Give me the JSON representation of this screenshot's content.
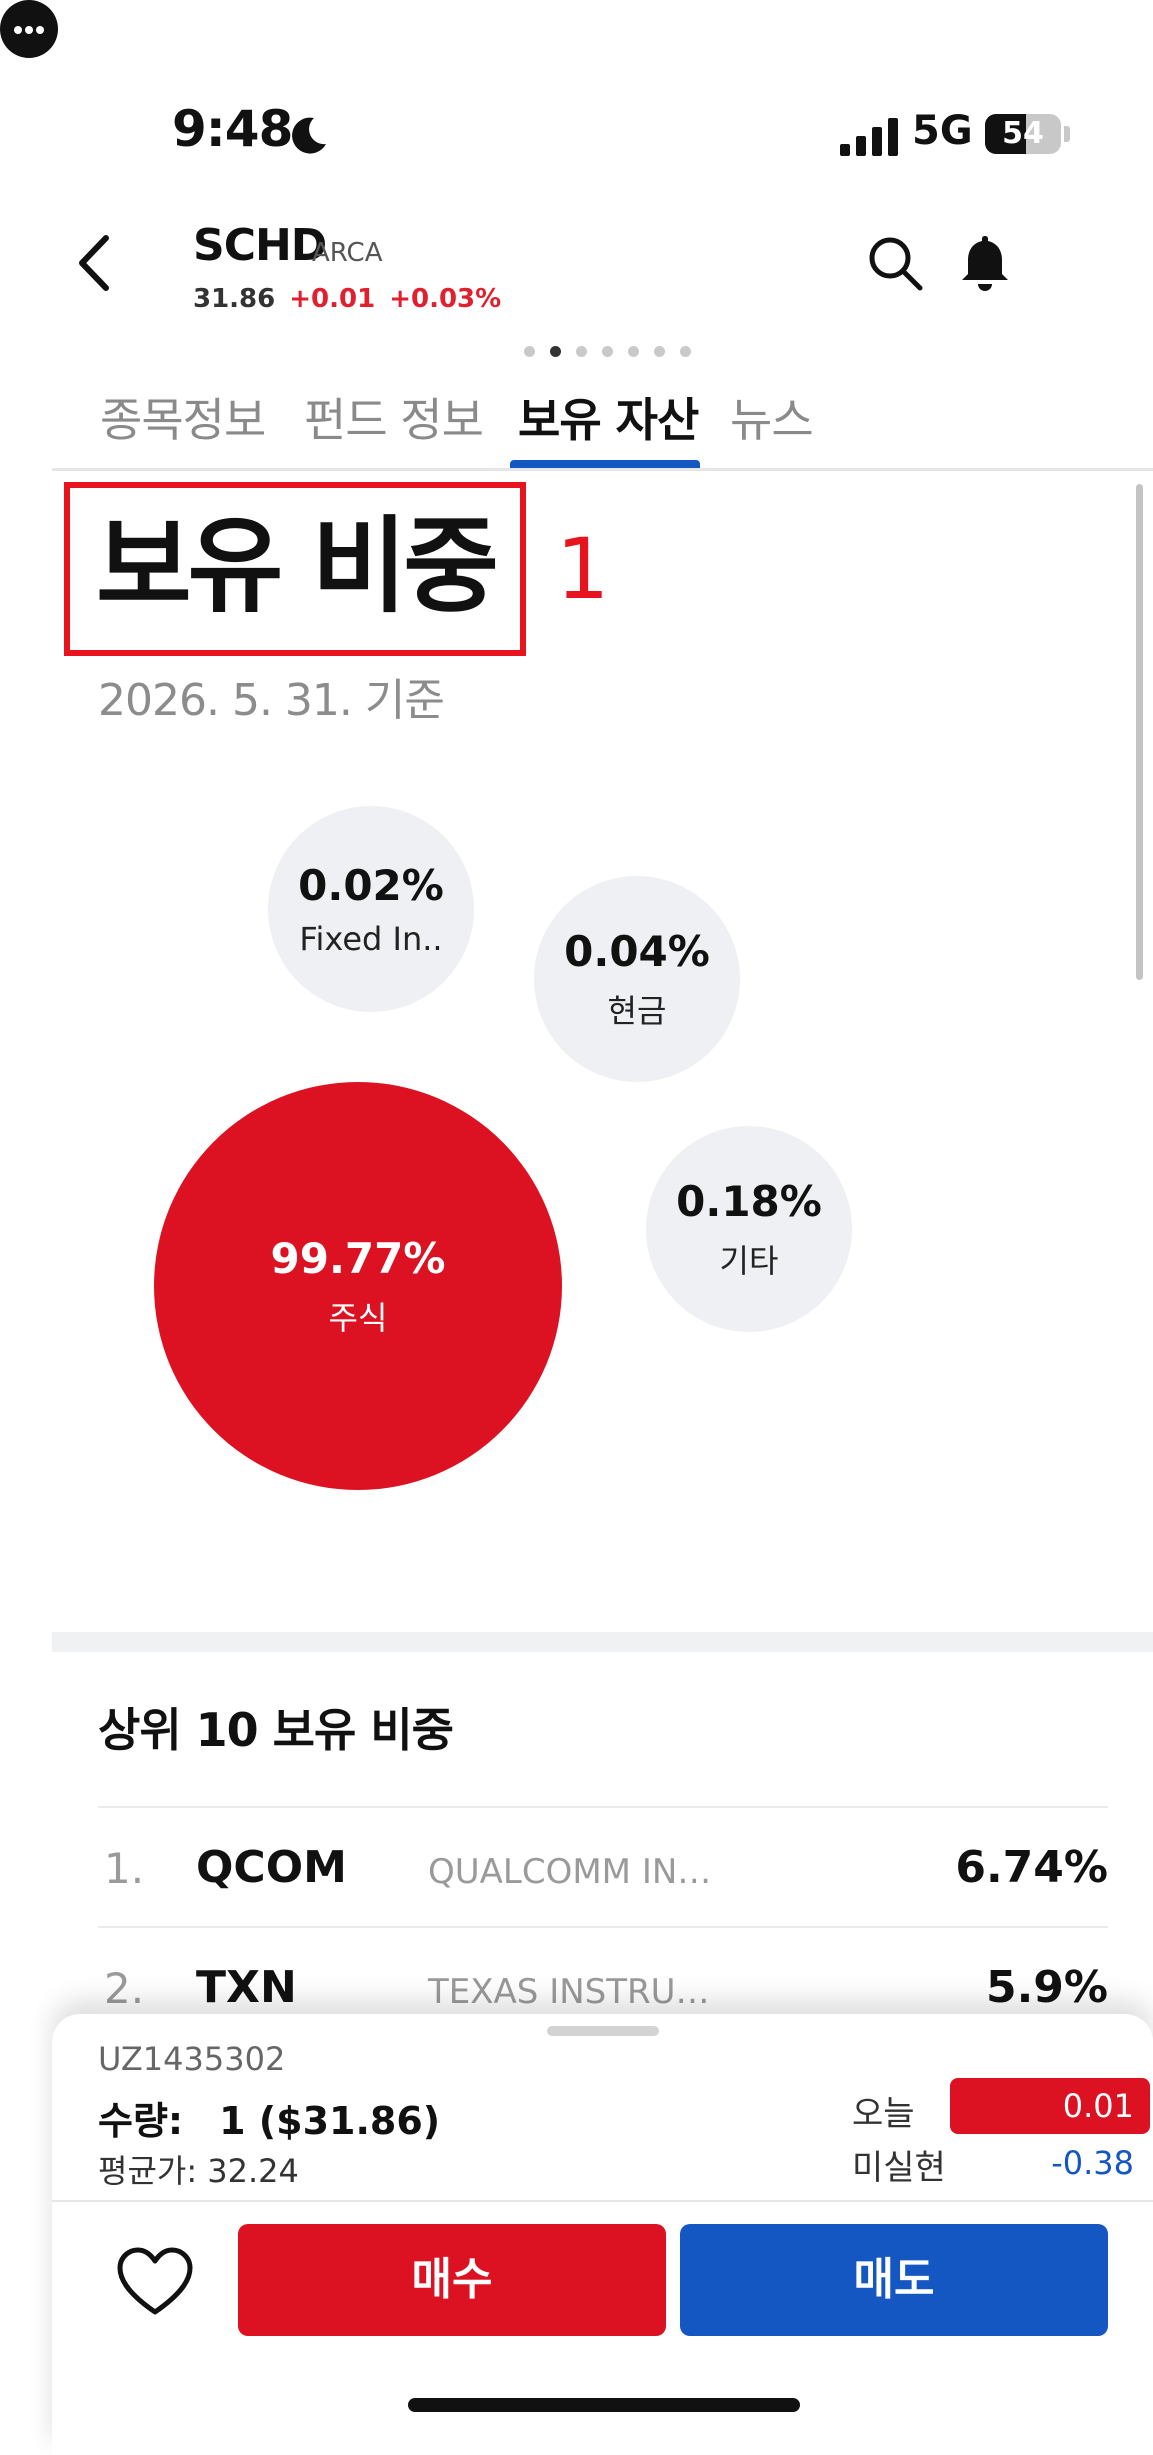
{
  "status_bar": {
    "time": "9:48",
    "network": "5G",
    "battery": "54",
    "battery_level": 0.54
  },
  "header": {
    "ticker": "SCHD",
    "exchange": "ARCA",
    "price": "31.86",
    "change": "+0.01",
    "change_pct": "+0.03%",
    "icons": [
      "back-arrow-icon",
      "search-icon",
      "bell-icon",
      "more-icon"
    ]
  },
  "pager": {
    "count": 7,
    "active": 1
  },
  "tabs": [
    {
      "label": "종목정보",
      "active": false
    },
    {
      "label": "펀드 정보",
      "active": false
    },
    {
      "label": "보유 자산",
      "active": true
    },
    {
      "label": "뉴스",
      "active": false
    }
  ],
  "section": {
    "title": "보유 비중",
    "annotation": "1",
    "as_of": "2026. 5. 31. 기준"
  },
  "chart_data": {
    "type": "bubble",
    "points": [
      {
        "label": "Fixed In..",
        "value": 0.02,
        "text": "0.02%"
      },
      {
        "label": "현금",
        "value": 0.04,
        "text": "0.04%"
      },
      {
        "label": "주식",
        "value": 99.77,
        "text": "99.77%"
      },
      {
        "label": "기타",
        "value": 0.18,
        "text": "0.18%"
      }
    ]
  },
  "top_holdings": {
    "title": "상위 10 보유 비중",
    "rows": [
      {
        "rank": "1.",
        "symbol": "QCOM",
        "name": "QUALCOMM IN…",
        "weight": "6.74%"
      },
      {
        "rank": "2.",
        "symbol": "TXN",
        "name": "TEXAS INSTRU…",
        "weight": "5.9%"
      }
    ]
  },
  "account": {
    "id": "UZ1435302",
    "qty_label": "수량:",
    "qty_value": "1 ($31.86)",
    "avg_price": "평균가: 32.24",
    "today_label": "오늘",
    "today_value": "0.01",
    "unrealized_label": "미실현",
    "unrealized_value": "-0.38"
  },
  "actions": {
    "buy": "매수",
    "sell": "매도"
  },
  "colors": {
    "accent_red": "#dc1122",
    "accent_blue": "#1457c2",
    "annotation_red": "#e8141d"
  }
}
